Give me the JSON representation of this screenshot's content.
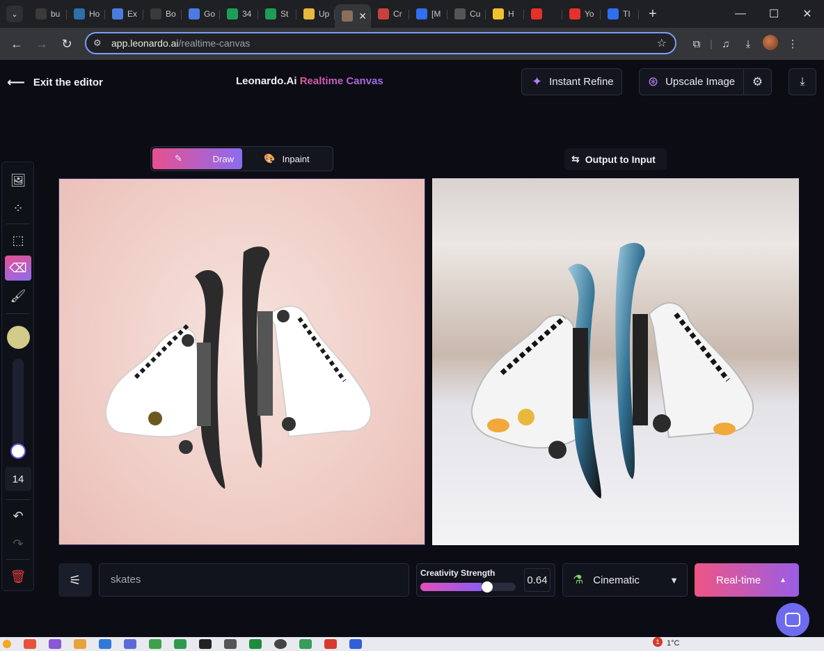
{
  "browser": {
    "tabs": [
      {
        "title": "bu",
        "icon": "github-icon",
        "color": "#3a3a3a"
      },
      {
        "title": "Ho",
        "icon": "app-icon",
        "color": "#2d6fa8"
      },
      {
        "title": "Ex",
        "icon": "puzzle-icon",
        "color": "#4a7ce0"
      },
      {
        "title": "Bo",
        "icon": "openai-icon",
        "color": "#3a3a3a"
      },
      {
        "title": "Go",
        "icon": "translate-icon",
        "color": "#4a7ce0"
      },
      {
        "title": "34",
        "icon": "sheets-icon",
        "color": "#1e9d57"
      },
      {
        "title": "St",
        "icon": "sheets-icon",
        "color": "#1e9d57"
      },
      {
        "title": "Up",
        "icon": "course-icon",
        "color": "#e8b93a"
      },
      {
        "title": "",
        "icon": "leonardo-icon",
        "color": "#8a6f5a"
      },
      {
        "title": "Cr",
        "icon": "canva-icon",
        "color": "#c9423a"
      },
      {
        "title": "[M",
        "icon": "jira-icon",
        "color": "#2f6ff0"
      },
      {
        "title": "Cu",
        "icon": "globe-icon",
        "color": "#555"
      },
      {
        "title": "H",
        "icon": "emoji-icon",
        "color": "#f2c12e"
      },
      {
        "title": "",
        "icon": "youtube-icon",
        "color": "#e5312b"
      },
      {
        "title": "Yo",
        "icon": "youtube-icon",
        "color": "#e5312b"
      },
      {
        "title": "TI",
        "icon": "jira-icon",
        "color": "#2f6ff0"
      }
    ],
    "url_host": "app.leonardo.ai",
    "url_path": "/realtime-canvas"
  },
  "app": {
    "exit_label": "Exit the editor",
    "brand_name": "Leonardo.Ai",
    "brand_product": "Realtime Canvas",
    "instant_refine_label": "Instant Refine",
    "upscale_label": "Upscale Image",
    "mode_draw_label": "Draw",
    "mode_inpaint_label": "Inpaint",
    "output_to_input_label": "Output to Input",
    "brush_size": "14",
    "brush_color": "#d2cb8a",
    "prompt_value": "skates",
    "creativity_label": "Creativity Strength",
    "creativity_value": "0.64",
    "creativity_fraction": 0.64,
    "style_label": "Cinematic",
    "realtime_label": "Real-time"
  },
  "taskbar": {
    "notification_count": "1",
    "temperature": "1°C"
  }
}
